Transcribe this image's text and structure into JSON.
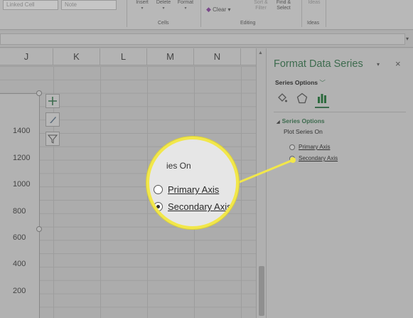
{
  "ribbon": {
    "style_boxes": [
      "Linked Cell",
      "Note"
    ],
    "cells_buttons": [
      "Insert",
      "Delete",
      "Format"
    ],
    "cells_group": "Cells",
    "clear_label": "Clear",
    "sort_label": "Sort &\nFilter",
    "find_label": "Find &\nSelect",
    "editing_group": "Editing",
    "ideas_button": "Ideas",
    "ideas_group": "Ideas"
  },
  "columns": [
    "J",
    "K",
    "L",
    "M",
    "N"
  ],
  "chart": {
    "y_ticks": [
      "1400",
      "1200",
      "1000",
      "800",
      "600",
      "400",
      "200"
    ]
  },
  "pane": {
    "title": "Format Data Series",
    "menu_label": "Series Options",
    "section_title": "Series Options",
    "plot_series_on": "Plot Series On",
    "options": [
      {
        "label": "Primary Axis",
        "selected": false
      },
      {
        "label": "Secondary Axis",
        "selected": true
      }
    ]
  },
  "magnifier": {
    "title_fragment": "ies On",
    "options": [
      {
        "label": "Primary Axis",
        "selected": false
      },
      {
        "label": "Secondary Axis",
        "selected": true
      }
    ]
  },
  "colors": {
    "highlight": "#f2e74a",
    "accent_green": "#3d6b4e"
  },
  "icons": [
    "fill-line-icon",
    "effects-icon",
    "series-options-icon",
    "chart-elements-icon",
    "chart-styles-icon",
    "chart-filters-icon",
    "close-icon"
  ]
}
